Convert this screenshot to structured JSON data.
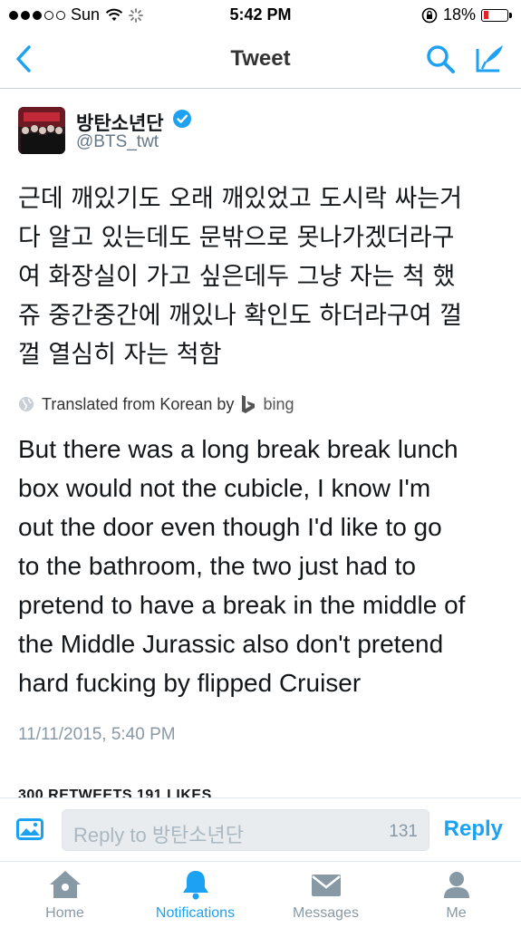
{
  "status_bar": {
    "carrier": "Sun",
    "time": "5:42 PM",
    "battery": "18%"
  },
  "nav": {
    "title": "Tweet"
  },
  "tweet": {
    "author_name": "방탄소년단",
    "author_handle": "@BTS_twt",
    "original_lines": [
      "근데 깨있기도 오래 깨있었고 도시락 싸는거",
      "다 알고 있는데도 문밖으로 못나가겠더라구",
      "여 화장실이 가고 싶은데두 그냥 자는 척 했",
      "쥬 중간중간에 깨있나 확인도 하더라구여 껄",
      "껄 열심히 자는 척함"
    ],
    "translated_from": "Translated from Korean by",
    "translator": "bing",
    "translated_lines": [
      "But there was a long break break lunch",
      "box would not the cubicle, I know I'm",
      "out the door even though I'd like to go",
      "to the bathroom, the two just had to",
      "pretend to have a break in the middle of",
      "the Middle Jurassic also don't pretend",
      "hard fucking by flipped Cruiser"
    ],
    "timestamp": "11/11/2015, 5:40 PM",
    "stats": "300 RETWEETS  191 LIKES"
  },
  "reply": {
    "placeholder": "Reply to 방탄소년단",
    "char_count": "131",
    "button_label": "Reply"
  },
  "tabs": [
    {
      "label": "Home",
      "icon": "home-icon"
    },
    {
      "label": "Notifications",
      "icon": "bell-icon"
    },
    {
      "label": "Messages",
      "icon": "envelope-icon"
    },
    {
      "label": "Me",
      "icon": "person-icon"
    }
  ],
  "colors": {
    "accent": "#1da1f2",
    "muted": "#8899a6",
    "battery_low": "#e0242b"
  }
}
